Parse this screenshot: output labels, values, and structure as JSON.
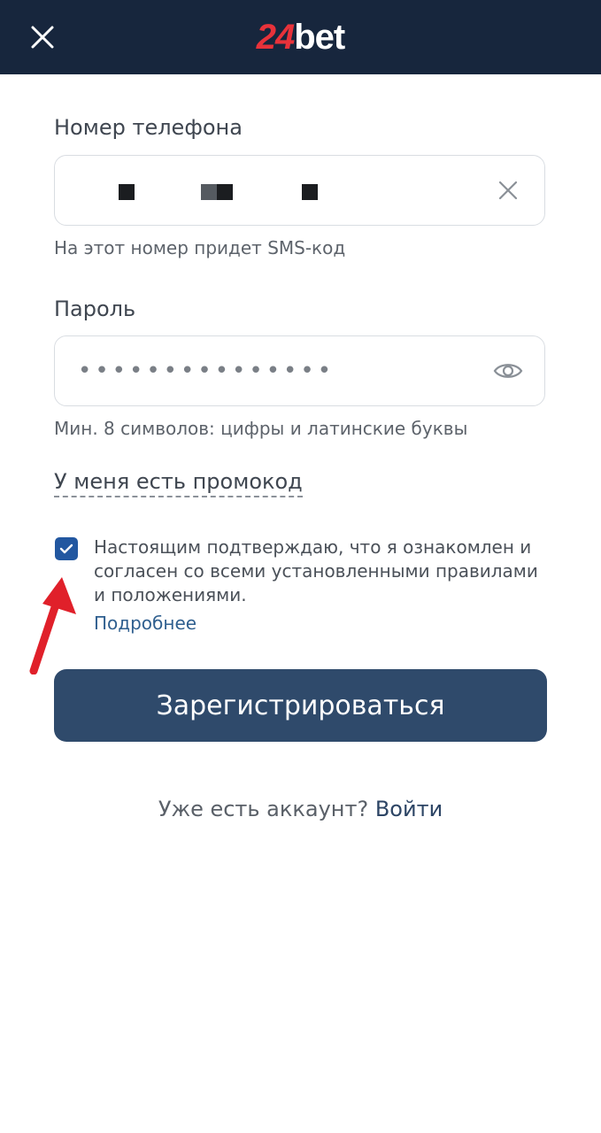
{
  "header": {
    "logo_number": "24",
    "logo_word": "bet"
  },
  "phone": {
    "label": "Номер телефона",
    "hint": "На этот номер придет SMS-код"
  },
  "password": {
    "label": "Пароль",
    "value_masked": "•••••••••••••••",
    "hint": "Мин. 8 символов: цифры и латинские буквы"
  },
  "promo": {
    "label": "У меня есть промокод"
  },
  "agreement": {
    "checked": true,
    "text": "Настоящим подтверждаю, что я ознакомлен и согласен со всеми установленными правилами и положениями.",
    "more_label": "Подробнее"
  },
  "register_button": {
    "label": "Зарегистрироваться"
  },
  "login": {
    "prompt": "Уже есть аккаунт?",
    "link_label": "Войти"
  },
  "icons": {
    "close": "close-icon",
    "clear": "clear-icon",
    "show_password": "eye-icon",
    "checkbox": "check-icon",
    "annotation": "red-arrow-icon"
  },
  "colors": {
    "header_bg": "#17263d",
    "brand_red": "#e8323a",
    "primary_button": "#2f4a6b",
    "checkbox": "#2257a0",
    "link": "#2f5f8f",
    "annotation_arrow": "#e0202a"
  }
}
